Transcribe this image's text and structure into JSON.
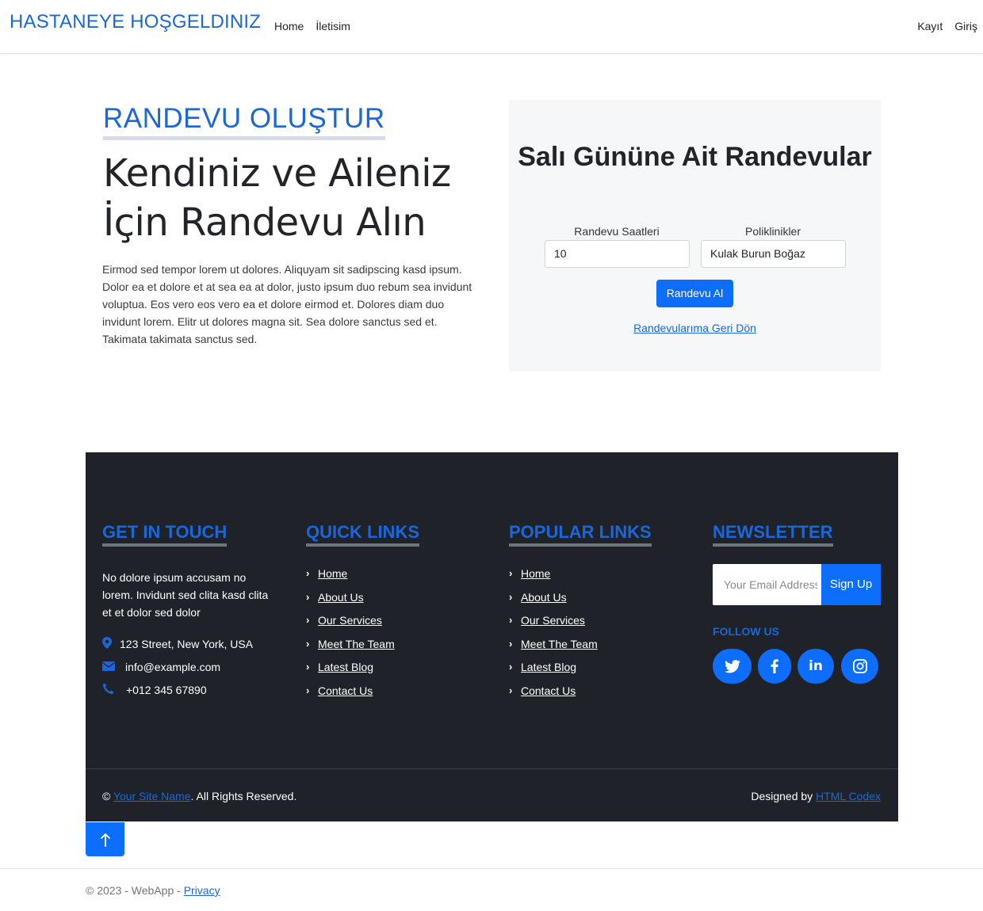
{
  "navbar": {
    "brand": "HASTANEYE HOŞGELDINIZ",
    "left_links": [
      "Home",
      "İletisim"
    ],
    "right_links": [
      "Kayıt",
      "Giriş"
    ]
  },
  "hero": {
    "eyebrow": "RANDEVU OLUŞTUR",
    "headline": "Kendiniz ve Aileniz İçin Randevu Alın",
    "body": "Eirmod sed tempor lorem ut dolores. Aliquyam sit sadipscing kasd ipsum. Dolor ea et dolore et at sea ea at dolor, justo ipsum duo rebum sea invidunt voluptua. Eos vero eos vero ea et dolore eirmod et. Dolores diam duo invidunt lorem. Elitr ut dolores magna sit. Sea dolore sanctus sed et. Takimata takimata sanctus sed."
  },
  "booking": {
    "title": "Salı Gününe Ait Randevular",
    "time_label": "Randevu Saatleri",
    "time_value": "10",
    "clinic_label": "Poliklinikler",
    "clinic_value": "Kulak Burun Boğaz",
    "submit_label": "Randevu Al",
    "back_link": "Randevularıma Geri Dön"
  },
  "footer": {
    "contact": {
      "title": "GET IN TOUCH",
      "text": "No dolore ipsum accusam no lorem. Invidunt sed clita kasd clita et et dolor sed dolor",
      "address": "123 Street, New York, USA",
      "email": "info@example.com",
      "phone": "+012 345 67890"
    },
    "quick_links": {
      "title": "QUICK LINKS",
      "items": [
        "Home",
        "About Us",
        "Our Services",
        "Meet The Team",
        "Latest Blog",
        "Contact Us"
      ]
    },
    "popular_links": {
      "title": "POPULAR LINKS",
      "items": [
        "Home",
        "About Us",
        "Our Services",
        "Meet The Team",
        "Latest Blog",
        "Contact Us"
      ]
    },
    "newsletter": {
      "title": "NEWSLETTER",
      "placeholder": "Your Email Address",
      "button": "Sign Up",
      "follow_label": "FOLLOW US",
      "social_icons": [
        "twitter-icon",
        "facebook-icon",
        "linkedin-icon",
        "instagram-icon"
      ]
    },
    "copyright_prefix": "©",
    "site_name": "Your Site Name",
    "rights": ". All Rights Reserved.",
    "designed_by": "Designed by",
    "designer": "HTML Codex"
  },
  "back_to_top_icon": "arrow-up-icon",
  "page_footer": {
    "text": "© 2023 - WebApp -",
    "privacy": "Privacy"
  },
  "colors": {
    "accent": "#1a67d8",
    "button": "#0d6efd",
    "footer_bg": "#1f2329",
    "card_bg": "#f6f7f9"
  }
}
